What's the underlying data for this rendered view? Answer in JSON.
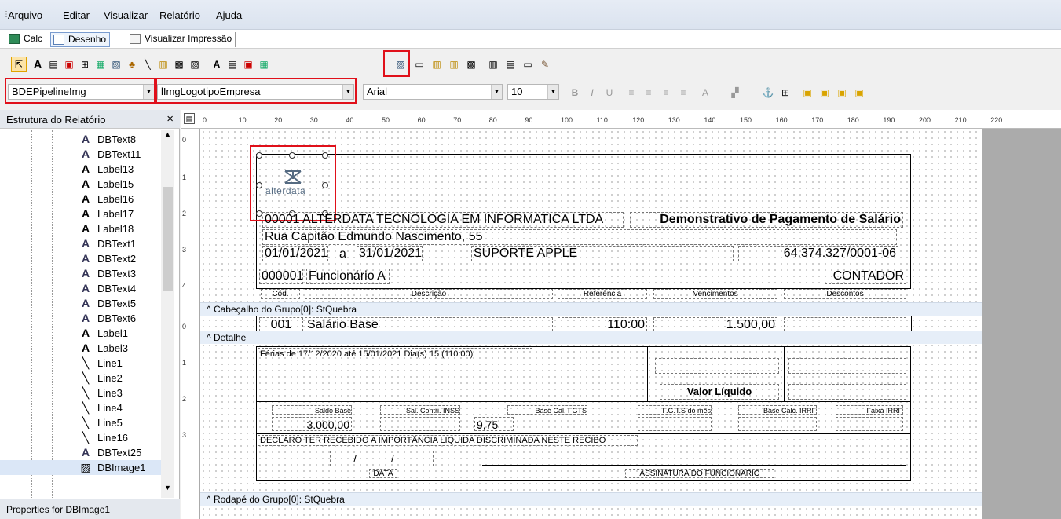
{
  "menu": {
    "items": [
      "Arquivo",
      "Editar",
      "Visualizar",
      "Relatório",
      "Ajuda"
    ]
  },
  "tabs": [
    {
      "label": "Calc",
      "icon": "calculator-icon"
    },
    {
      "label": "Desenho",
      "icon": "pencil-icon"
    },
    {
      "label": "Visualizar Impressão",
      "icon": "print-preview-icon"
    }
  ],
  "toolbar": {
    "pipeline": "BDEPipelineImg",
    "component": "lImgLogotipoEmpresa",
    "font": "Arial",
    "font_size": "10",
    "bold": "B",
    "italic": "I",
    "underline": "U",
    "text_color": "A"
  },
  "left_panel": {
    "title": "Estrutura do Relatório",
    "close": "×",
    "footer": "Properties for DBImage1",
    "items": [
      {
        "label": "DBText8",
        "type": "dbtext"
      },
      {
        "label": "DBText11",
        "type": "dbtext"
      },
      {
        "label": "Label13",
        "type": "label"
      },
      {
        "label": "Label15",
        "type": "label"
      },
      {
        "label": "Label16",
        "type": "label"
      },
      {
        "label": "Label17",
        "type": "label"
      },
      {
        "label": "Label18",
        "type": "label"
      },
      {
        "label": "DBText1",
        "type": "dbtext"
      },
      {
        "label": "DBText2",
        "type": "dbtext"
      },
      {
        "label": "DBText3",
        "type": "dbtext"
      },
      {
        "label": "DBText4",
        "type": "dbtext"
      },
      {
        "label": "DBText5",
        "type": "dbtext"
      },
      {
        "label": "DBText6",
        "type": "dbtext"
      },
      {
        "label": "Label1",
        "type": "label"
      },
      {
        "label": "Label3",
        "type": "label"
      },
      {
        "label": "Line1",
        "type": "line"
      },
      {
        "label": "Line2",
        "type": "line"
      },
      {
        "label": "Line3",
        "type": "line"
      },
      {
        "label": "Line4",
        "type": "line"
      },
      {
        "label": "Line5",
        "type": "line"
      },
      {
        "label": "Line16",
        "type": "line"
      },
      {
        "label": "DBText25",
        "type": "dbtext"
      },
      {
        "label": "DBImage1",
        "type": "image"
      }
    ]
  },
  "ruler": {
    "top": [
      "0",
      "10",
      "20",
      "30",
      "40",
      "50",
      "60",
      "70",
      "80",
      "90",
      "100",
      "110",
      "120",
      "130",
      "140",
      "150",
      "160",
      "170",
      "180",
      "190",
      "200",
      "210",
      "220"
    ],
    "left_a": [
      "0",
      "1",
      "2",
      "3",
      "4"
    ],
    "left_b": [
      "0",
      "1",
      "2",
      "3"
    ]
  },
  "bands": {
    "group_header": "^ Cabeçalho do Grupo[0]: StQuebra",
    "detail": "^ Detalhe",
    "group_footer": "^ Rodapé do Grupo[0]: StQuebra"
  },
  "report": {
    "logo_text": "alterdata",
    "company": "00001 ALTERDATA TECNOLOGIA EM INFORMATICA LTDA",
    "title": "Demonstrativo de Pagamento de Salário",
    "address": "Rua Capitão Edmundo Nascimento, 55",
    "date_from": "01/01/2021",
    "date_sep": "a",
    "date_to": "31/01/2021",
    "department": "SUPORTE APPLE",
    "cnpj": "64.374.327/0001-06",
    "employee_code": "000001",
    "employee_name": "Funcionário A",
    "role": "CONTADOR",
    "col_cod": "Cód.",
    "col_desc": "Descrição",
    "col_ref": "Referência",
    "col_venc": "Vencimentos",
    "col_desc2": "Descontos",
    "row_cod": "001",
    "row_desc": "Salário Base",
    "row_ref": "110:00",
    "row_venc": "1.500,00",
    "vacation": "Férias de 17/12/2020 até 15/01/2021 Dia(s) 15 (110:00)",
    "net_label": "Valor Líquido",
    "f_saldo": "Saldo Base",
    "f_inss": "Sal. Contri. INSS",
    "f_fgts": "Base Cal. FGTS",
    "f_fgtsmes": "F.G.T.S do mês",
    "f_irrf": "Base Calc. IRRF",
    "f_faixa": "Faixa IRRF",
    "v_saldo": "3.000,00",
    "v_fgts": "9,75",
    "declaration": "DECLARO TER RECEBIDO A IMPORTÂNCIA LIQUIDA DISCRIMINADA NESTE RECIBO",
    "date_blank": "/ /",
    "date_label": "DATA",
    "signature_label": "ASSINATURA DO FUNCIONARIO"
  }
}
